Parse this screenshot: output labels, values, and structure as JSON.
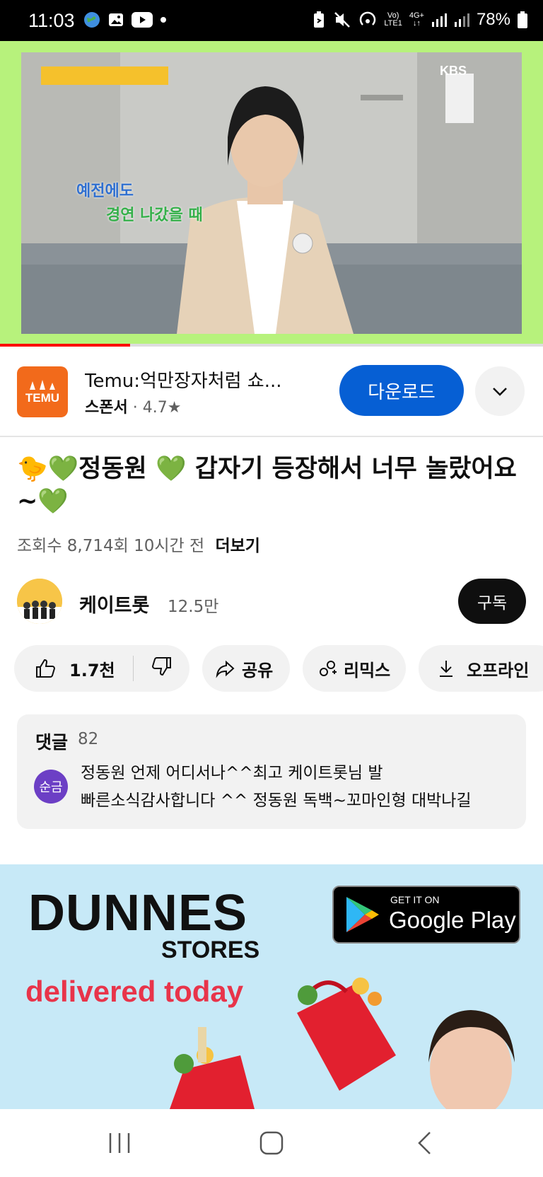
{
  "status_bar": {
    "time": "11:03",
    "network_top": "Vo)",
    "network_bottom": "LTE1",
    "data_top": "4G+",
    "battery": "78%"
  },
  "video": {
    "progress_fraction": 0.24,
    "overlay_caption_line1": "예전에도",
    "overlay_caption_line2": "경연 나갔을 때",
    "broadcaster": "KBS"
  },
  "ad": {
    "logo_text": "TEMU",
    "title": "Temu:억만장자처럼 쇼...",
    "sponsor_label": "스폰서",
    "rating": "· 4.7★",
    "download_label": "다운로드"
  },
  "video_info": {
    "title": "🐤💚정동원 💚 갑자기 등장해서 너무 놀랐어요~💚",
    "meta": "조회수 8,714회  10시간 전",
    "more_label": "더보기"
  },
  "channel": {
    "name": "케이트롯",
    "subscribers": "12.5만",
    "subscribe_label": "구독"
  },
  "actions": {
    "like_count": "1.7천",
    "share_label": "공유",
    "remix_label": "리믹스",
    "offline_label": "오프라인"
  },
  "comments": {
    "heading": "댓글",
    "count": "82",
    "top_avatar_text": "순금",
    "top_comment": "정동원 언제 어디서나^^최고 케이트롯님 발 빠른소식감사합니다 ^^ 정동원 독백~꼬마인형 대박나길 응원합니다"
  },
  "dunnes_ad": {
    "brand": "DUNNES",
    "stores": "STORES",
    "tagline": "delivered today",
    "store_small": "GET IT ON",
    "store_big": "Google Play"
  },
  "colors": {
    "accent_blue": "#065fd4",
    "youtube_red": "#ff0000",
    "temu_orange": "#f26a1b",
    "video_border_green": "#b7f27c",
    "dunnes_bg": "#c7e9f7",
    "dunnes_red": "#e8344a"
  }
}
